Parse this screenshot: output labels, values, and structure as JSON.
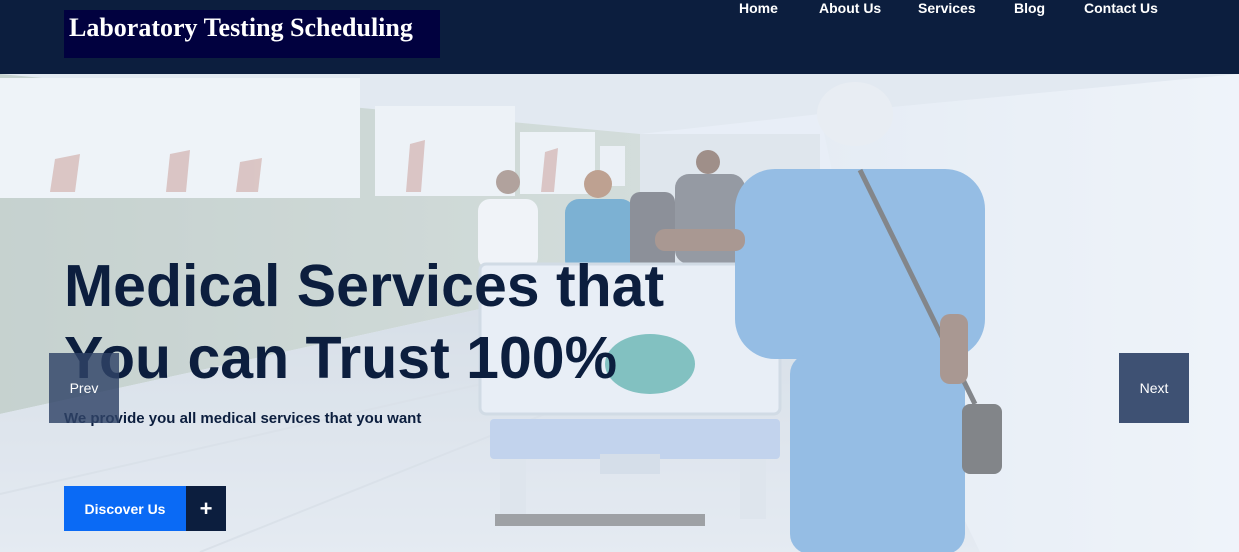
{
  "header": {
    "logo_text": "Laboratory Testing Scheduling",
    "nav": {
      "home": "Home",
      "about": "About Us",
      "services": "Services",
      "blog": "Blog",
      "contact": "Contact Us"
    }
  },
  "hero": {
    "headline_line1": "Medical Services that",
    "headline_line2": "You can Trust 100%",
    "subtext": "We provide you all medical services that you want",
    "discover_label": "Discover Us",
    "plus_label": "+",
    "prev_label": "Prev",
    "next_label": "Next"
  },
  "colors": {
    "header_bg": "#0c1e3e",
    "logo_bg": "#01013f",
    "accent": "#0a6af5",
    "headline": "#0c1e3e"
  }
}
